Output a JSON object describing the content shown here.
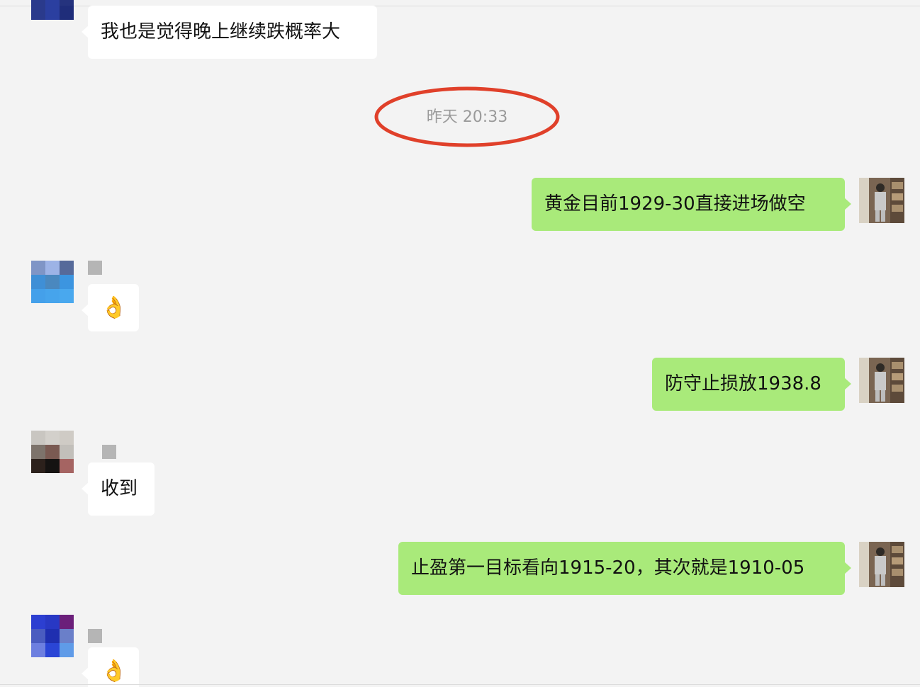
{
  "chat": {
    "timestamp": "昨天 20:33",
    "messages": [
      {
        "direction": "in",
        "text": "我也是觉得晚上继续跌概率大"
      },
      {
        "direction": "out",
        "text": "黄金目前1929-30直接进场做空"
      },
      {
        "direction": "in",
        "text": "👌"
      },
      {
        "direction": "out",
        "text": "防守止损放1938.8"
      },
      {
        "direction": "in",
        "text": "收到"
      },
      {
        "direction": "out",
        "text": "止盈第一目标看向1915-20，其次就是1910-05"
      },
      {
        "direction": "in",
        "text": "👌"
      }
    ]
  },
  "colors": {
    "background": "#f3f3f3",
    "incoming_bubble": "#ffffff",
    "outgoing_bubble": "#a9ea7a",
    "highlight_ring": "#e0402a",
    "timestamp_text": "#9a9a9a"
  },
  "icons": {
    "ok_hand": "ok-hand-emoji"
  }
}
